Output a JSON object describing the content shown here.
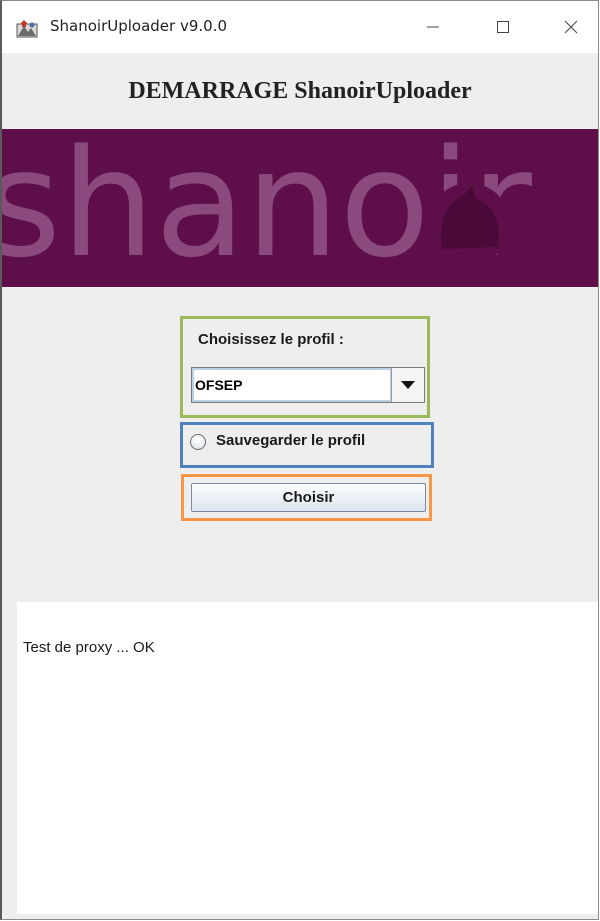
{
  "window": {
    "title": "ShanoirUploader v9.0.0",
    "icons": {
      "app": "shanoir-app-icon",
      "minimize": "minimize-icon",
      "maximize": "maximize-icon",
      "close": "close-icon"
    }
  },
  "header": {
    "title": "DEMARRAGE ShanoirUploader"
  },
  "banner": {
    "logo_text": "shanoir",
    "background": "#5e0f49",
    "logo_color": "#8a4a7e"
  },
  "profile": {
    "label": "Choisissez le profil :",
    "selected": "OFSEP",
    "dropdown_icon": "caret-down-icon"
  },
  "save_profile": {
    "label": "Sauvegarder le profil",
    "checked": false
  },
  "choose_button": {
    "label": "Choisir"
  },
  "log": {
    "text": "Test de proxy ... OK"
  },
  "highlight_colors": {
    "profile": "#9bbb59",
    "save": "#4f81bd",
    "choose": "#f79646"
  }
}
